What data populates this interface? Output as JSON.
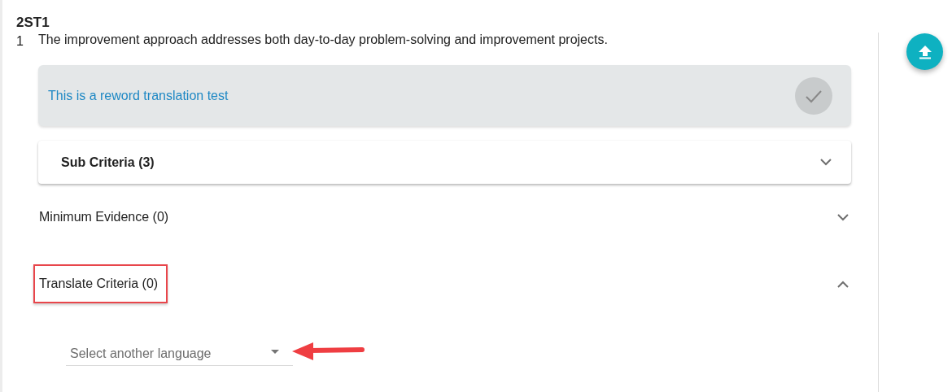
{
  "criterion": {
    "code": "2ST1",
    "statement": {
      "number": "1",
      "text": "The improvement approach addresses both day-to-day problem-solving and improvement projects."
    },
    "reword": {
      "text": "This is a reword translation test"
    },
    "sections": [
      {
        "kind": "card",
        "title": "Sub Criteria (3)",
        "expanded": false,
        "highlighted": false
      },
      {
        "kind": "plain",
        "title": "Minimum Evidence (0)",
        "expanded": false,
        "highlighted": false
      },
      {
        "kind": "plain",
        "title": "Translate Criteria (0)",
        "expanded": true,
        "highlighted": true,
        "field": {
          "placeholder": "Select another language"
        }
      }
    ]
  }
}
